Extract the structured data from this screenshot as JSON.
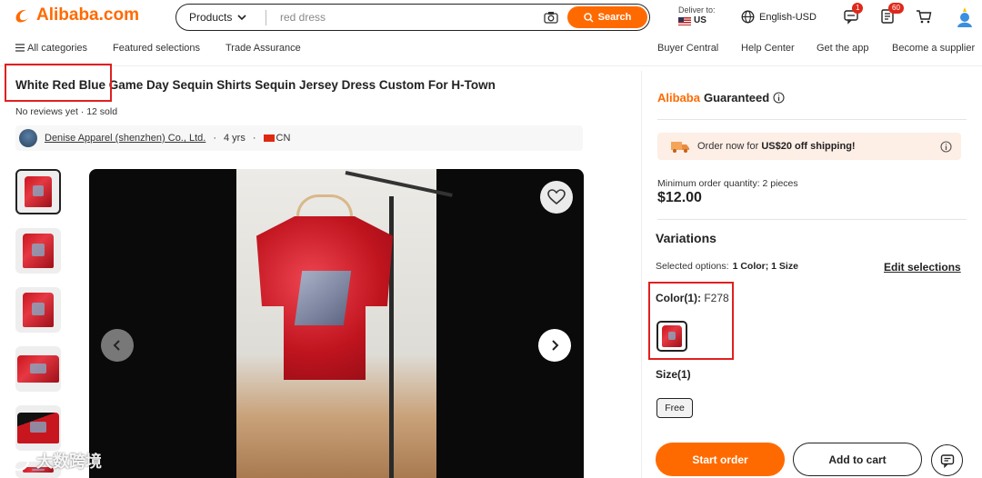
{
  "header": {
    "logo_text": "Alibaba.com",
    "search": {
      "category": "Products",
      "query": "red dress",
      "button_label": "Search"
    },
    "deliver": {
      "label": "Deliver to:",
      "country": "US"
    },
    "language_currency": "English-USD",
    "messages_badge": "1",
    "orders_badge": "60"
  },
  "nav": {
    "all_categories": "All categories",
    "featured": "Featured selections",
    "trade_assurance": "Trade Assurance",
    "buyer_central": "Buyer Central",
    "help_center": "Help Center",
    "get_app": "Get the app",
    "become_supplier": "Become a supplier"
  },
  "product": {
    "title": "White Red Blue Game Day Sequin Shirts Sequin Jersey Dress Custom For H-Town",
    "reviews": "No reviews yet",
    "sold": "12 sold",
    "meta_separator": " · ",
    "supplier_name": "Denise Apparel (shenzhen) Co., Ltd.",
    "supplier_years": "4 yrs",
    "supplier_country": "CN"
  },
  "watermark": "大数跨境",
  "panel": {
    "guaranteed_brand": "Alibaba",
    "guaranteed_word": "Guaranteed",
    "promo_prefix": "Order now for ",
    "promo_bold": "US$20 off shipping!",
    "moq": "Minimum order quantity: 2 pieces",
    "price": "$12.00",
    "variations_title": "Variations",
    "selected_label": "Selected options:",
    "selected_value": "1 Color; 1 Size",
    "edit_selections": "Edit selections",
    "color_label": "Color(1):",
    "color_value": "F278",
    "size_label": "Size(1)",
    "size_value": "Free",
    "start_order": "Start order",
    "add_to_cart": "Add to cart"
  },
  "colors": {
    "brand_orange": "#ff6a00",
    "highlight_red": "#e02020",
    "promo_bg": "#fdeee6"
  },
  "icons": [
    "logo-icon",
    "chevron-down-icon",
    "camera-icon",
    "search-icon",
    "us-flag-icon",
    "globe-icon",
    "message-icon",
    "orders-icon",
    "cart-icon",
    "profile-icon",
    "menu-icon",
    "info-icon",
    "truck-icon",
    "heart-icon",
    "chevron-left-icon",
    "chevron-right-icon",
    "chat-icon",
    "cn-flag-icon"
  ]
}
